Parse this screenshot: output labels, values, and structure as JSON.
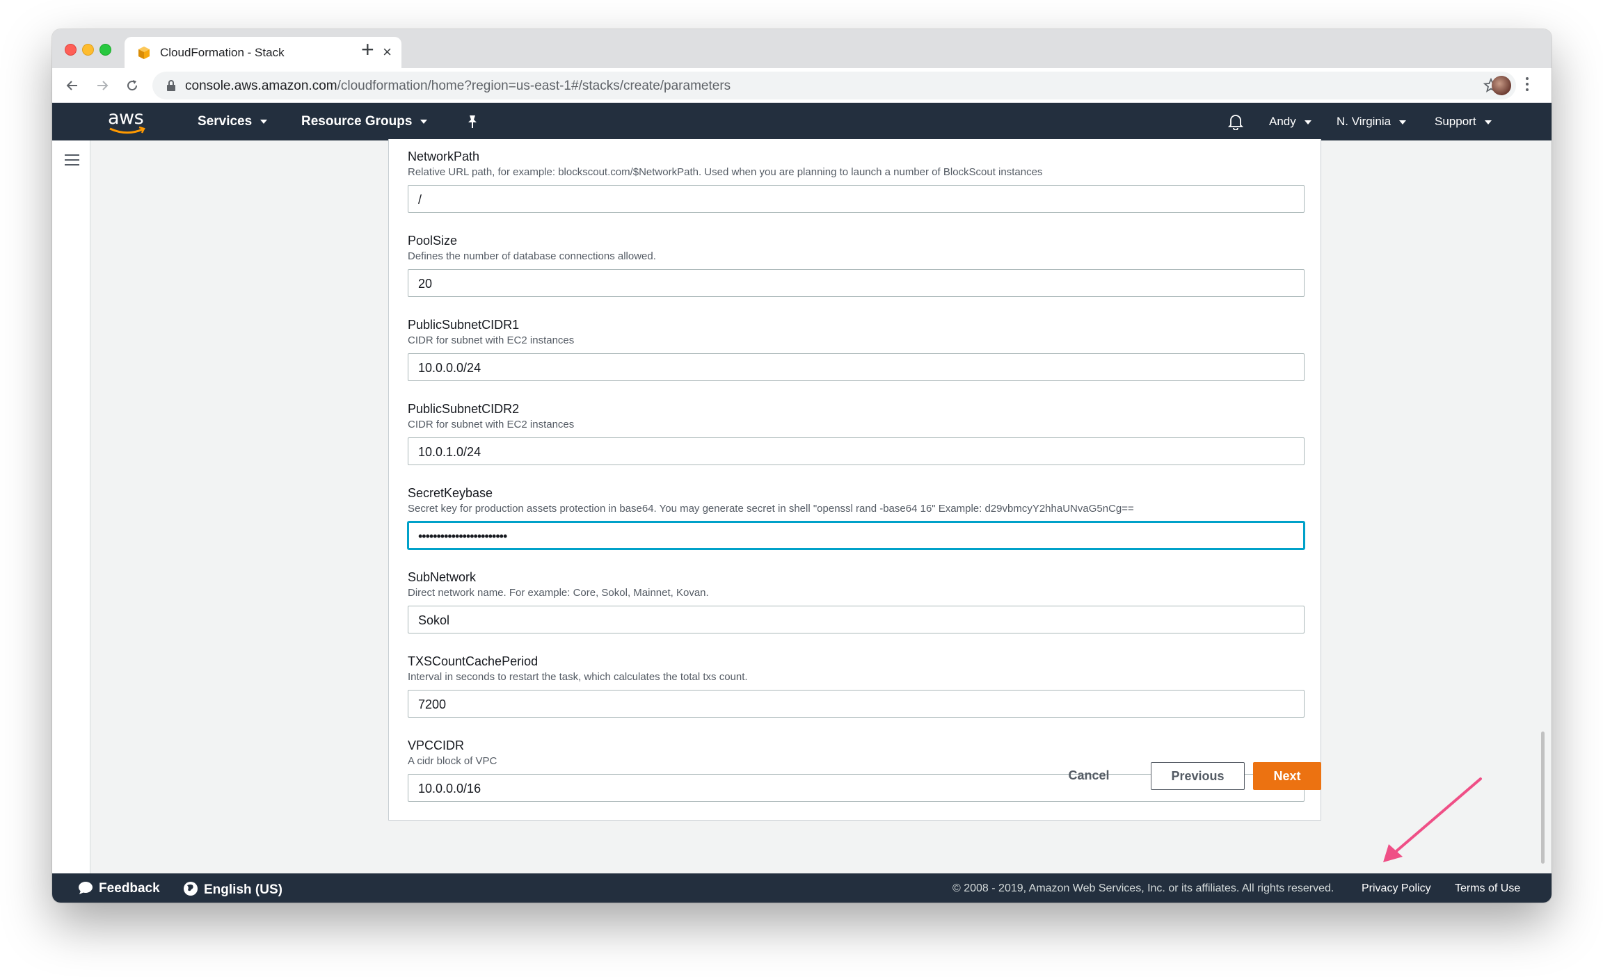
{
  "browser": {
    "tab_title": "CloudFormation - Stack",
    "tab_close": "×",
    "new_tab": "+",
    "url_host": "console.aws.amazon.com",
    "url_path": "/cloudformation/home?region=us-east-1#/stacks/create/parameters"
  },
  "aws_nav": {
    "logo": "aws",
    "services": "Services",
    "resource_groups": "Resource Groups",
    "user": "Andy",
    "region": "N. Virginia",
    "support": "Support"
  },
  "parameters": [
    {
      "label": "NetworkPath",
      "description": "Relative URL path, for example: blockscout.com/$NetworkPath. Used when you are planning to launch a number of BlockScout instances",
      "value": "/"
    },
    {
      "label": "PoolSize",
      "description": "Defines the number of database connections allowed.",
      "value": "20"
    },
    {
      "label": "PublicSubnetCIDR1",
      "description": "CIDR for subnet with EC2 instances",
      "value": "10.0.0.0/24"
    },
    {
      "label": "PublicSubnetCIDR2",
      "description": "CIDR for subnet with EC2 instances",
      "value": "10.0.1.0/24"
    },
    {
      "label": "SecretKeybase",
      "description": "Secret key for production assets protection in base64. You may generate secret in shell \"openssl rand -base64 16\" Example: d29vbmcyY2hhaUNvaG5nCg==",
      "value": "••••••••••••••••••••••••"
    },
    {
      "label": "SubNetwork",
      "description": "Direct network name. For example: Core, Sokol, Mainnet, Kovan.",
      "value": "Sokol"
    },
    {
      "label": "TXSCountCachePeriod",
      "description": "Interval in seconds to restart the task, which calculates the total txs count.",
      "value": "7200"
    },
    {
      "label": "VPCCIDR",
      "description": "A cidr block of VPC",
      "value": "10.0.0.0/16"
    }
  ],
  "actions": {
    "cancel": "Cancel",
    "previous": "Previous",
    "next": "Next"
  },
  "footer": {
    "feedback": "Feedback",
    "language": "English (US)",
    "copyright": "© 2008 - 2019, Amazon Web Services, Inc. or its affiliates. All rights reserved.",
    "privacy": "Privacy Policy",
    "terms": "Terms of Use"
  },
  "colors": {
    "aws_nav": "#232f3e",
    "primary_button": "#ec7211",
    "focus_border": "#00a1c9",
    "annotation_arrow": "#ef4f86"
  }
}
